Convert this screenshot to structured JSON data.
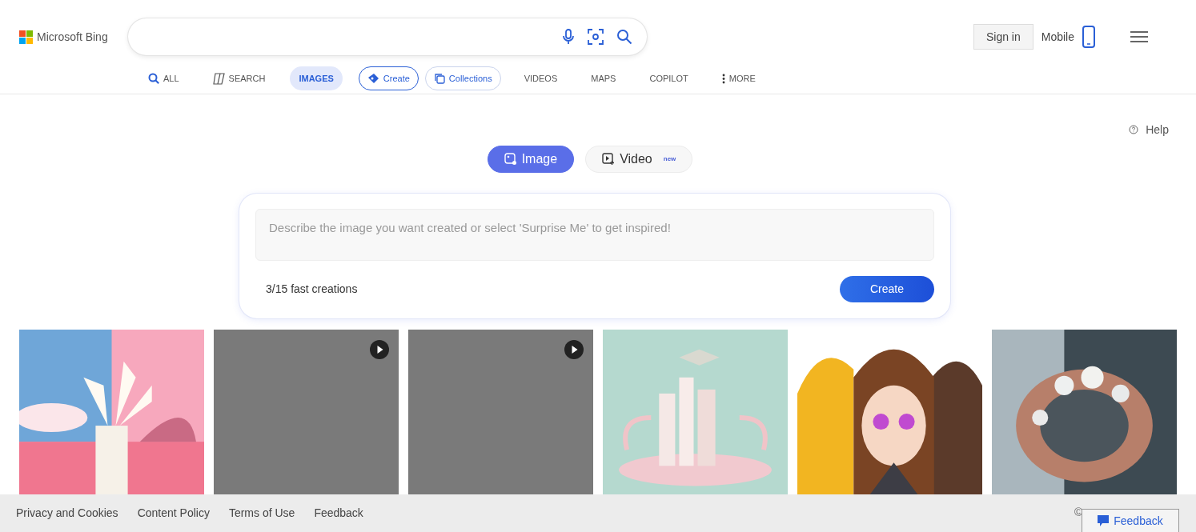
{
  "header": {
    "logo": "Microsoft Bing",
    "sign_in": "Sign in",
    "mobile": "Mobile"
  },
  "nav": [
    {
      "label": "ALL",
      "selected": false,
      "kind": "plain"
    },
    {
      "label": "SEARCH",
      "selected": false,
      "kind": "plain"
    },
    {
      "label": "IMAGES",
      "selected": true,
      "kind": "plain"
    },
    {
      "label": "Create",
      "selected": false,
      "kind": "outlined"
    },
    {
      "label": "Collections",
      "selected": false,
      "kind": "outlined"
    },
    {
      "label": "VIDEOS",
      "selected": false,
      "kind": "plain"
    },
    {
      "label": "MAPS",
      "selected": false,
      "kind": "plain"
    },
    {
      "label": "COPILOT",
      "selected": false,
      "kind": "plain"
    },
    {
      "label": "MORE",
      "selected": false,
      "kind": "plain"
    }
  ],
  "help": "Help",
  "mode_tabs": [
    {
      "label": "Image",
      "selected": true
    },
    {
      "label": "Video",
      "badge": "new",
      "selected": false
    }
  ],
  "prompt": {
    "placeholder": "Describe the image you want created or select 'Surprise Me' to get inspired!",
    "credits": "3/15 fast creations",
    "button": "Create"
  },
  "gallery": [
    {
      "kind": "picture"
    },
    {
      "kind": "video"
    },
    {
      "kind": "video"
    },
    {
      "kind": "picture"
    },
    {
      "kind": "picture"
    },
    {
      "kind": "picture"
    }
  ],
  "footer": {
    "links": [
      "Privacy and Cookies",
      "Content Policy",
      "Terms of Use",
      "Feedback"
    ],
    "copyright": "©",
    "feedback_button": "Feedback"
  }
}
